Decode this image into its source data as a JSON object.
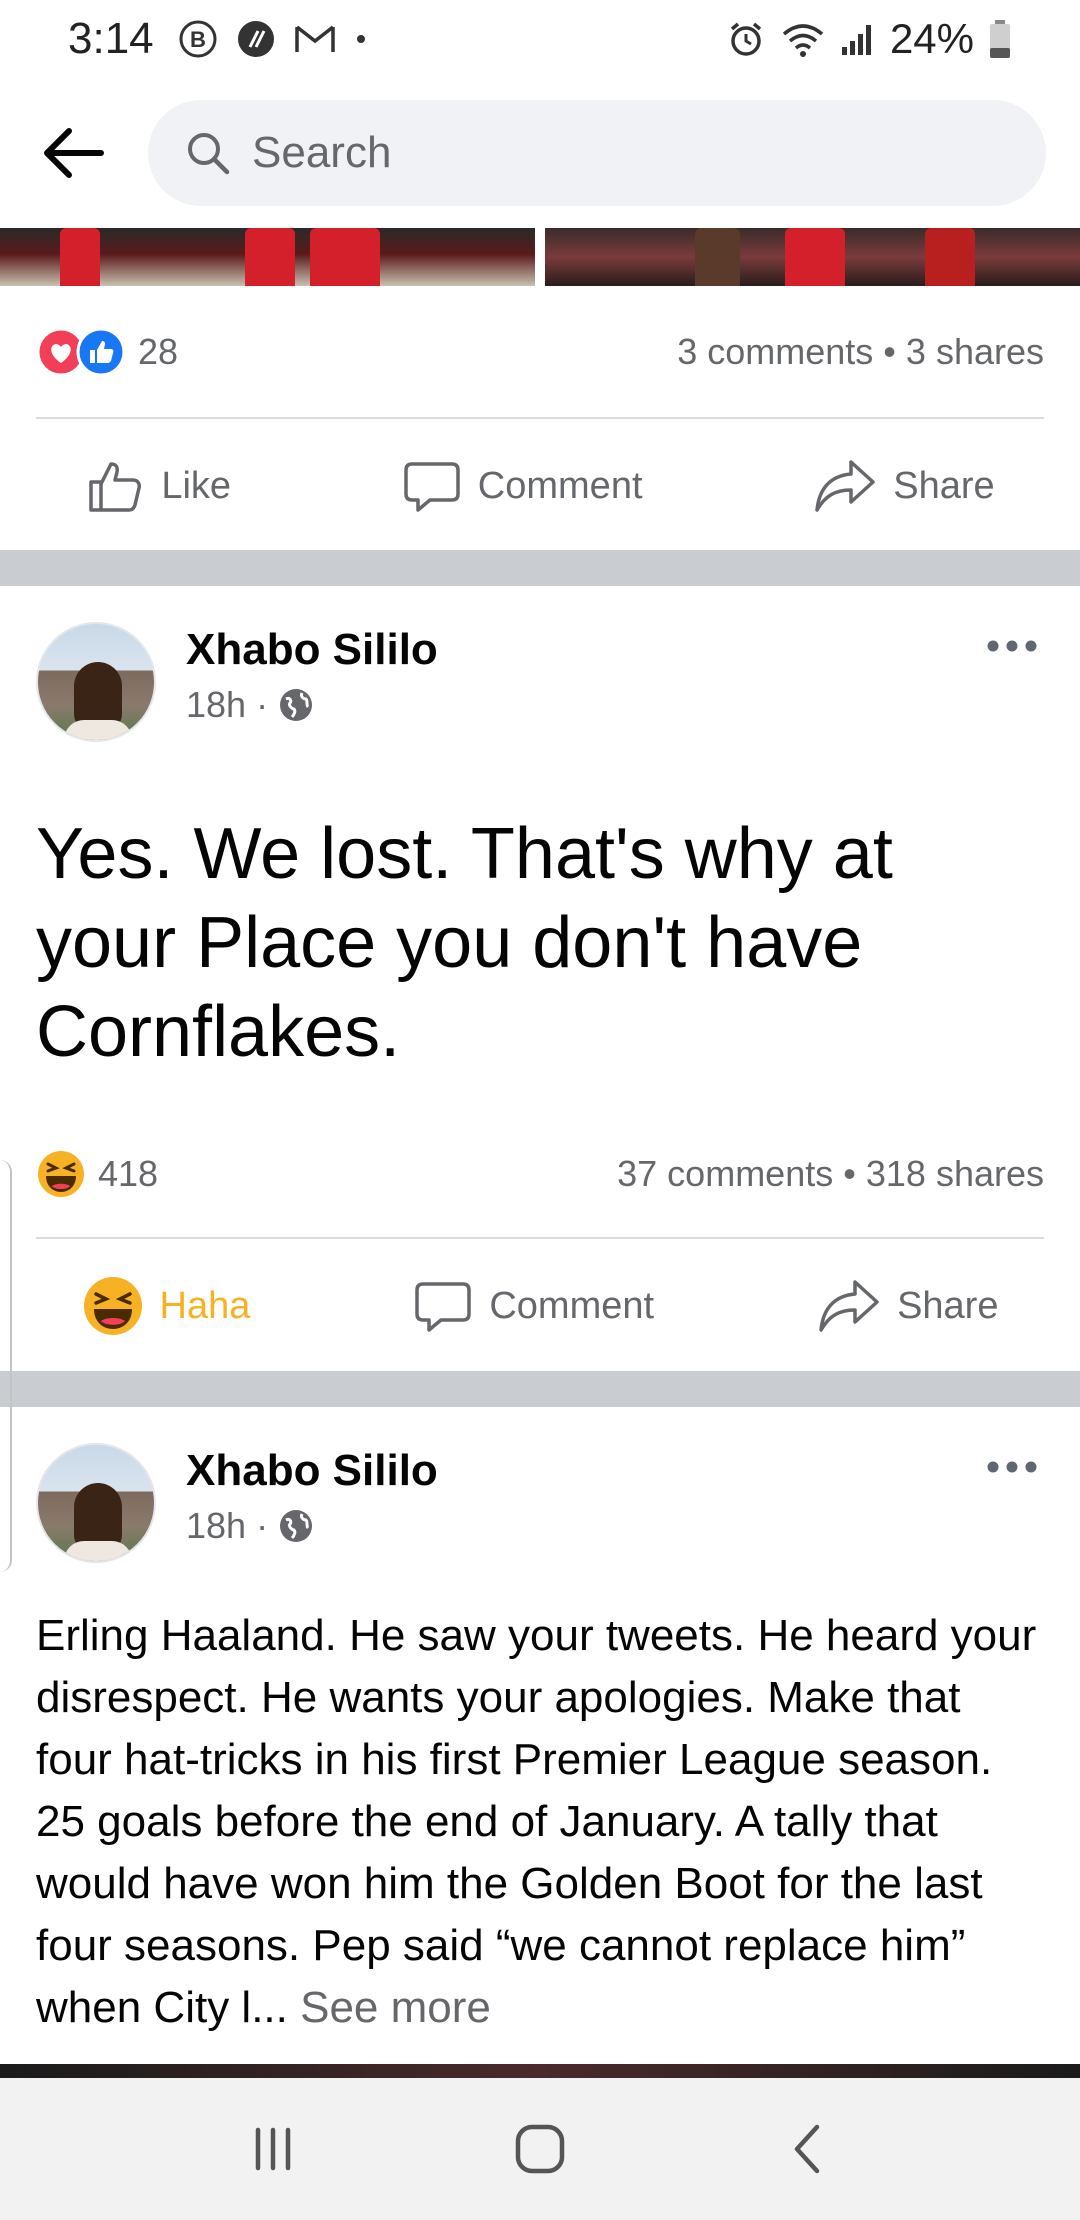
{
  "status_bar": {
    "time": "3:14",
    "battery": "24%",
    "left_icons": [
      "b-circle-icon",
      "slash-circle-icon",
      "gmail-icon",
      "dot-icon"
    ],
    "right_icons": [
      "alarm-icon",
      "wifi-icon",
      "signal-icon",
      "battery-icon"
    ]
  },
  "header": {
    "search_placeholder": "Search"
  },
  "post1": {
    "reaction_count": "28",
    "comments": "3 comments",
    "shares": "3 shares",
    "stat_separator": "•",
    "actions": {
      "like": "Like",
      "comment": "Comment",
      "share": "Share"
    }
  },
  "post2": {
    "author": "Xhabo Sililo",
    "time": "18h",
    "meta_separator": "·",
    "text": "Yes. We lost. That's why at your Place you don't have Cornflakes.",
    "reaction_count": "418",
    "comments": "37 comments",
    "shares": "318 shares",
    "stat_separator": "•",
    "actions": {
      "reaction": "Haha",
      "comment": "Comment",
      "share": "Share"
    }
  },
  "post3": {
    "author": "Xhabo Sililo",
    "time": "18h",
    "meta_separator": "·",
    "text": "Erling Haaland. He saw your tweets. He heard your disrespect. He wants your apologies. Make that four hat-tricks in his first Premier League season. 25 goals before the end of January. A tally that would have won him the Golden Boot for the last four seasons. Pep said “we cannot replace him” when City l...",
    "see_more": "See more"
  },
  "colors": {
    "accent_blue": "#1877f2",
    "love_red": "#f33e58",
    "haha_yellow": "#f7b125",
    "text_secondary": "#65676b",
    "separator_gray": "#c9ccd1"
  }
}
